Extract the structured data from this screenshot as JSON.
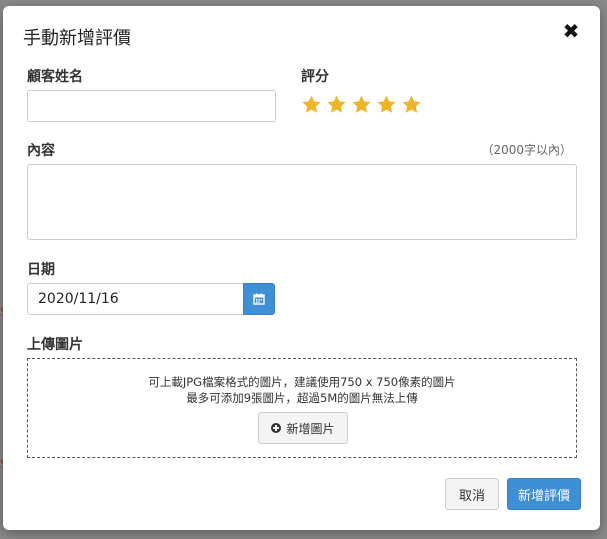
{
  "modal": {
    "title": "手動新增評價",
    "close_label": "✖"
  },
  "form": {
    "customer_name_label": "顧客姓名",
    "customer_name_value": "",
    "rating_label": "評分",
    "rating_value": 5,
    "rating_max": 5,
    "star_color": "#f0b429",
    "content_label": "內容",
    "content_hint": "（2000字以內）",
    "content_value": "",
    "date_label": "日期",
    "date_value": "2020/11/16",
    "upload_label": "上傳圖片",
    "upload_line1": "可上載JPG檔案格式的圖片，建議使用750 x 750像素的圖片",
    "upload_line2": "最多可添加9張圖片，超過5M的圖片無法上傳",
    "add_image_label": "新增圖片"
  },
  "footer": {
    "cancel_label": "取消",
    "submit_label": "新增評價"
  },
  "colors": {
    "primary": "#3f8fd6",
    "background_glyph": "#c0392b"
  },
  "background": {
    "edge_glyph": "S"
  }
}
